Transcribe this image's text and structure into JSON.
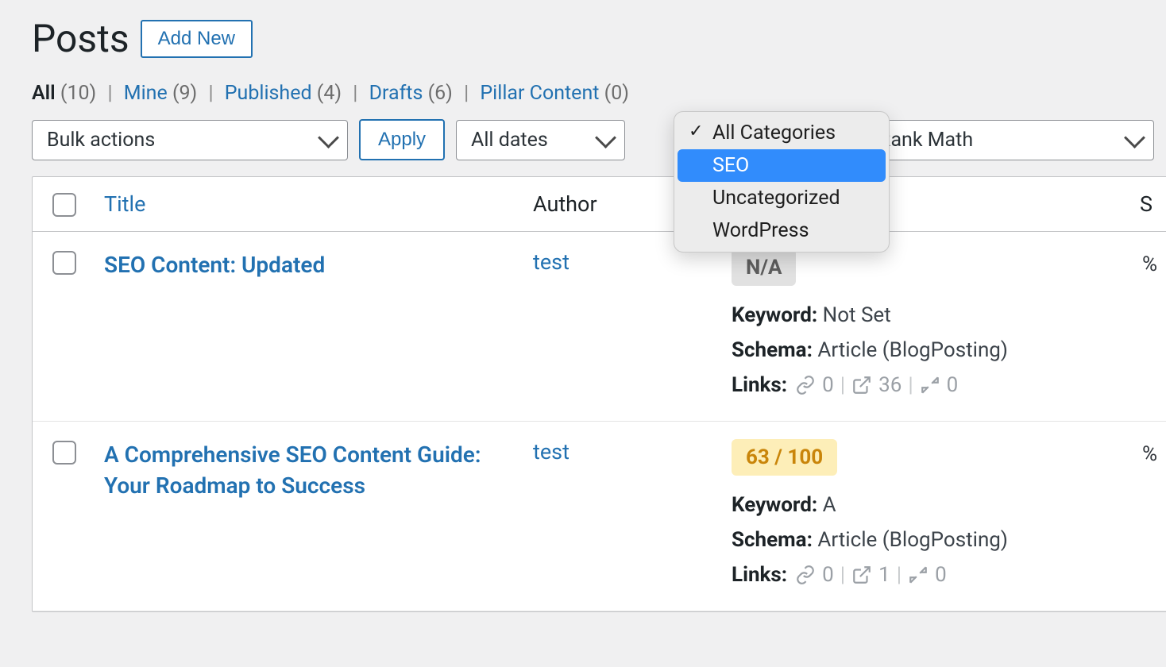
{
  "page": {
    "title": "Posts",
    "add_new_label": "Add New"
  },
  "filters": [
    {
      "label": "All",
      "count": "(10)",
      "current": true
    },
    {
      "label": "Mine",
      "count": "(9)",
      "current": false
    },
    {
      "label": "Published",
      "count": "(4)",
      "current": false
    },
    {
      "label": "Drafts",
      "count": "(6)",
      "current": false
    },
    {
      "label": "Pillar Content",
      "count": "(0)",
      "current": false
    }
  ],
  "toolbar": {
    "bulk_label": "Bulk actions",
    "apply_label": "Apply",
    "dates_label": "All dates",
    "rm_label": "Rank Math"
  },
  "category_dropdown": {
    "options": [
      {
        "label": "All Categories",
        "checked": true,
        "highlighted": false
      },
      {
        "label": "SEO",
        "checked": false,
        "highlighted": true
      },
      {
        "label": "Uncategorized",
        "checked": false,
        "highlighted": false
      },
      {
        "label": "WordPress",
        "checked": false,
        "highlighted": false
      }
    ]
  },
  "columns": {
    "title": "Title",
    "author": "Author",
    "right_partial": "S"
  },
  "rows": [
    {
      "title": "SEO Content: Updated",
      "author": "test",
      "score": "N/A",
      "score_class": "score-na",
      "keyword": "Not Set",
      "schema": "Article (BlogPosting)",
      "links_internal": "0",
      "links_external": "36",
      "links_incoming": "0",
      "pct": "%"
    },
    {
      "title": "A Comprehensive SEO Content Guide: Your Roadmap to Success",
      "author": "test",
      "score": "63 / 100",
      "score_class": "score-yellow",
      "keyword": "A",
      "schema": "Article (BlogPosting)",
      "links_internal": "0",
      "links_external": "1",
      "links_incoming": "0",
      "pct": "%"
    }
  ],
  "labels": {
    "keyword": "Keyword:",
    "schema": "Schema:",
    "links": "Links:"
  }
}
